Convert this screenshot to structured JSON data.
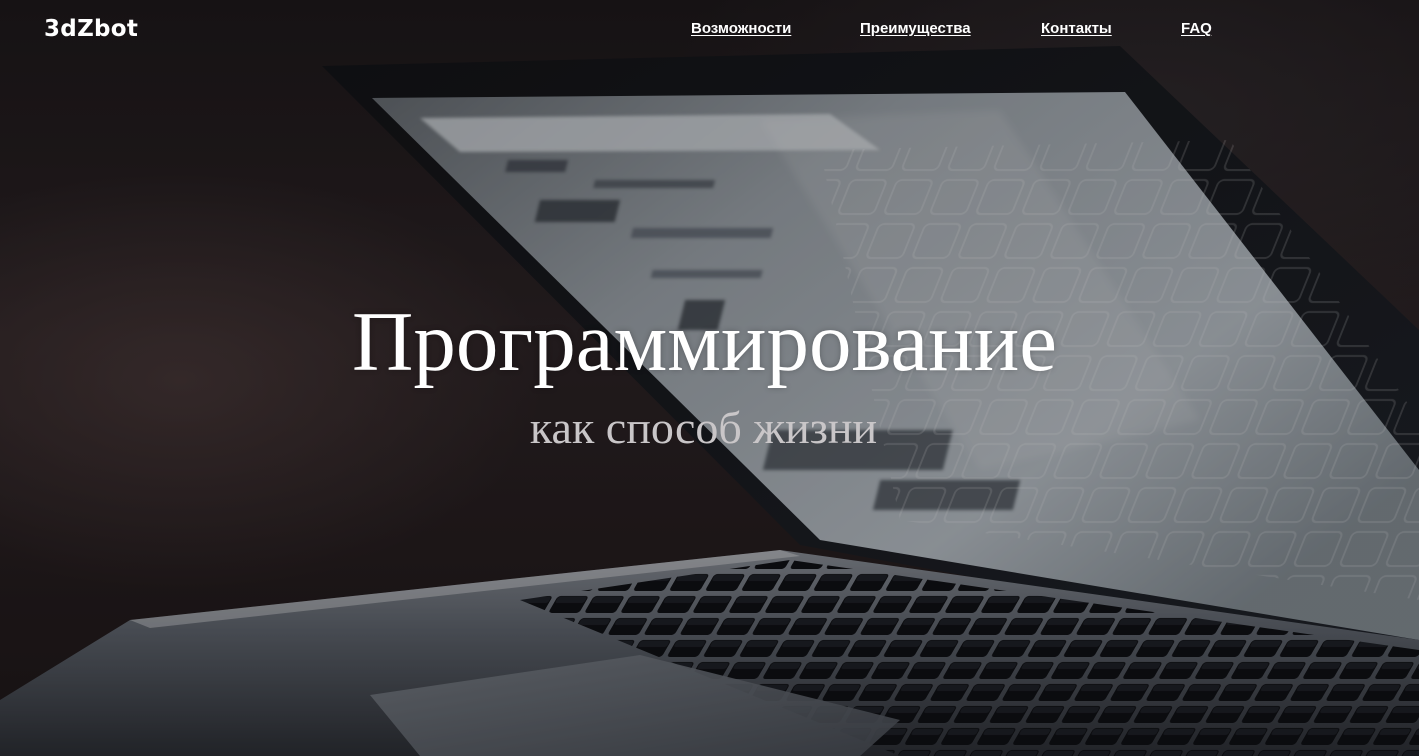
{
  "brand": {
    "logo_text": "3dZbot"
  },
  "nav": {
    "items": [
      {
        "label": "Возможности"
      },
      {
        "label": "Преимущества"
      },
      {
        "label": "Контакты"
      },
      {
        "label": "FAQ"
      }
    ]
  },
  "hero": {
    "title": "Программирование",
    "subtitle": "как способ жизни",
    "background_image": "laptop-photo"
  },
  "colors": {
    "text_primary": "#ffffff",
    "text_secondary": "#c9c6c8",
    "background": "#1b1718"
  }
}
